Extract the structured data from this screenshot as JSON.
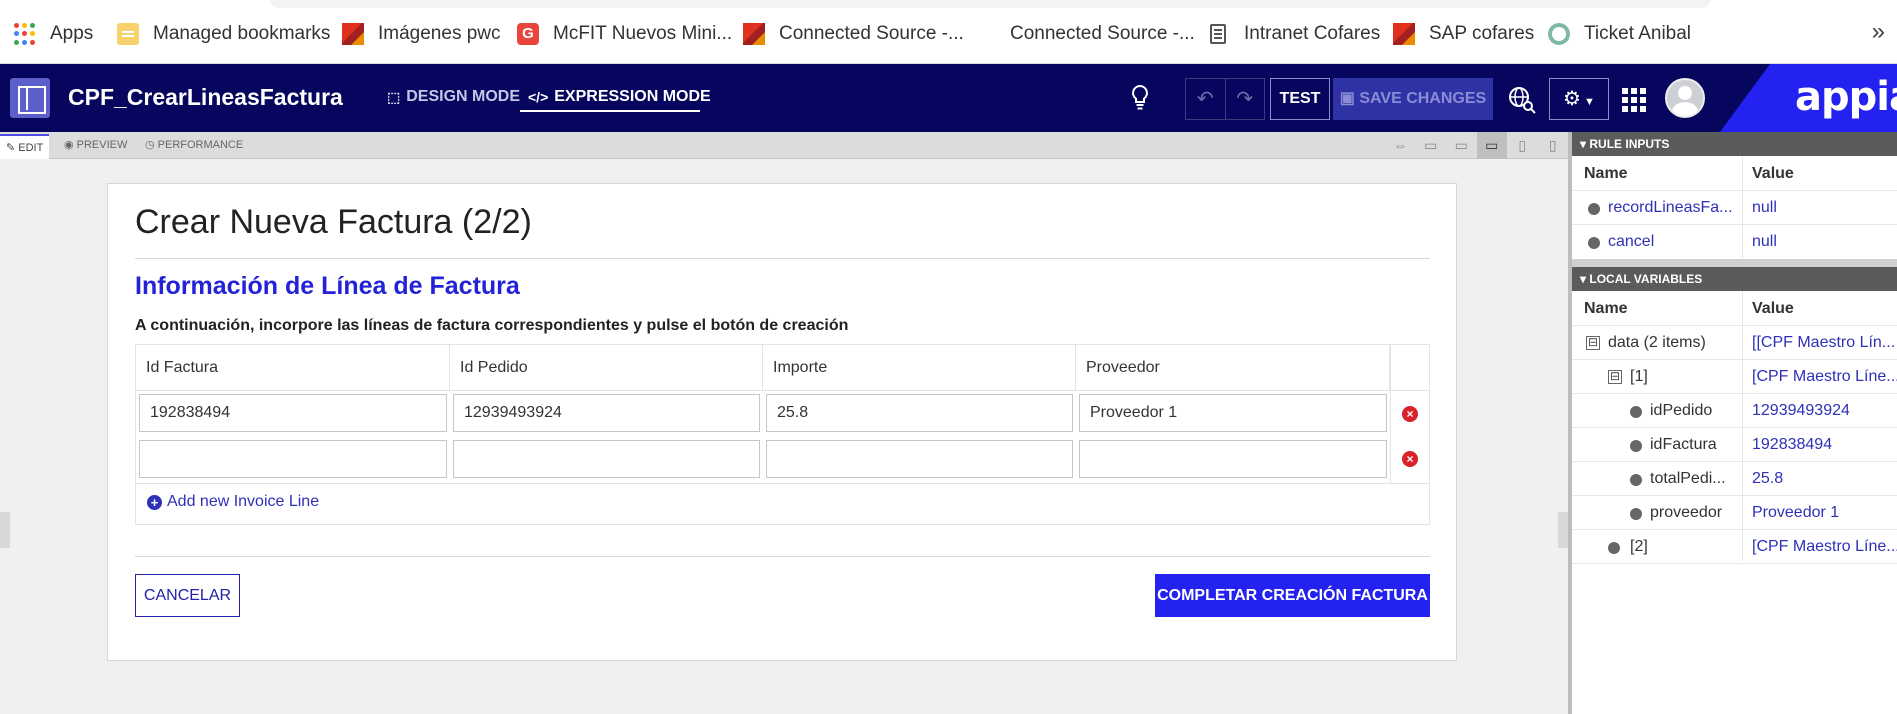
{
  "bookmarks": {
    "items": [
      {
        "label": "Apps",
        "icon": "apps-icon"
      },
      {
        "label": "Managed bookmarks",
        "icon": "folder-icon"
      },
      {
        "label": "Imágenes pwc",
        "icon": "pwc-icon"
      },
      {
        "label": "McFIT Nuevos Mini...",
        "icon": "g-icon"
      },
      {
        "label": "Connected Source -...",
        "icon": "pwc-icon"
      },
      {
        "label": "Connected Source -...",
        "icon": "none"
      },
      {
        "label": "Intranet Cofares",
        "icon": "document-icon"
      },
      {
        "label": "SAP cofares",
        "icon": "pwc-icon"
      },
      {
        "label": "Ticket Anibal",
        "icon": "ticket-icon"
      }
    ],
    "more": "»"
  },
  "header": {
    "title": "CPF_CrearLineasFactura",
    "design_mode": "DESIGN MODE",
    "expression_mode": "EXPRESSION MODE",
    "test": "TEST",
    "save_changes": "SAVE CHANGES",
    "brand": "appian",
    "colors": {
      "bar": "#06065e",
      "brand": "#2322f0"
    }
  },
  "subbar": {
    "edit": "EDIT",
    "preview": "PREVIEW",
    "performance": "PERFORMANCE"
  },
  "form": {
    "title": "Crear Nueva Factura (2/2)",
    "section": "Información de Línea de Factura",
    "instruction": "A continuación, incorpore las líneas de factura correspondientes y pulse el botón de creación",
    "columns": [
      "Id Factura",
      "Id Pedido",
      "Importe",
      "Proveedor"
    ],
    "rows": [
      [
        "192838494",
        "12939493924",
        "25.8",
        "Proveedor 1"
      ],
      [
        "",
        "",
        "",
        ""
      ]
    ],
    "add_line": "Add new Invoice Line",
    "cancel": "CANCELAR",
    "complete": "COMPLETAR CREACIÓN FACTURA",
    "accent": "#2322f0"
  },
  "rule_inputs": {
    "title": "RULE INPUTS",
    "col_name": "Name",
    "col_value": "Value",
    "rows": [
      {
        "name": "recordLineasFa...",
        "value": "null"
      },
      {
        "name": "cancel",
        "value": "null"
      }
    ]
  },
  "local_variables": {
    "title": "LOCAL VARIABLES",
    "col_name": "Name",
    "col_value": "Value",
    "rows": [
      {
        "name": "data (2 items)",
        "value": "[[CPF Maestro Lín...",
        "toggle": "⊟"
      },
      {
        "name": "[1]",
        "value": "[CPF Maestro Líne...",
        "toggle": "⊟"
      },
      {
        "name": "idPedido",
        "value": "12939493924"
      },
      {
        "name": "idFactura",
        "value": "192838494"
      },
      {
        "name": "totalPedi...",
        "value": "25.8"
      },
      {
        "name": "proveedor",
        "value": "Proveedor 1"
      },
      {
        "name": "[2]",
        "value": "[CPF Maestro Líne..."
      }
    ]
  }
}
